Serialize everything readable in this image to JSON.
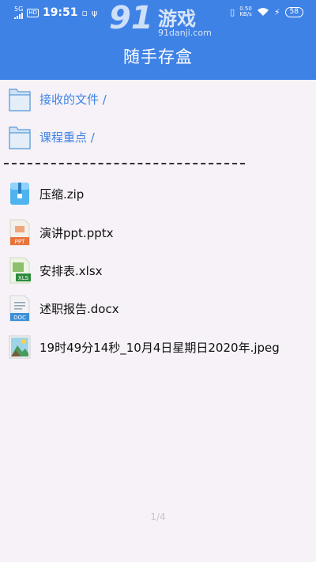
{
  "status_bar": {
    "network": "5G",
    "hd": "HD",
    "time": "19:51",
    "speed_value": "0.50",
    "speed_unit": "KB/s",
    "battery": "58"
  },
  "watermark": {
    "number": "91",
    "name": "游戏",
    "url": "91danji.com"
  },
  "header": {
    "title": "随手存盒"
  },
  "folders": [
    {
      "label": "接收的文件 /",
      "icon": "folder-icon"
    },
    {
      "label": "课程重点 /",
      "icon": "folder-icon"
    }
  ],
  "files": [
    {
      "label": "压缩.zip",
      "icon": "zip-file-icon"
    },
    {
      "label": "演讲ppt.pptx",
      "icon": "ppt-file-icon",
      "badge": "PPT"
    },
    {
      "label": "安排表.xlsx",
      "icon": "xls-file-icon",
      "badge": "XLS"
    },
    {
      "label": "述职报告.docx",
      "icon": "doc-file-icon",
      "badge": "DOC"
    },
    {
      "label": "19时49分14秒_10月4日星期日2020年.jpeg",
      "icon": "image-file-icon"
    }
  ],
  "pager": {
    "text": "1/4"
  },
  "colors": {
    "accent": "#3f82e6",
    "background": "#f6f2f7",
    "ppt": "#e8743b",
    "xls": "#2e8b3d",
    "doc": "#3a8fd9"
  }
}
